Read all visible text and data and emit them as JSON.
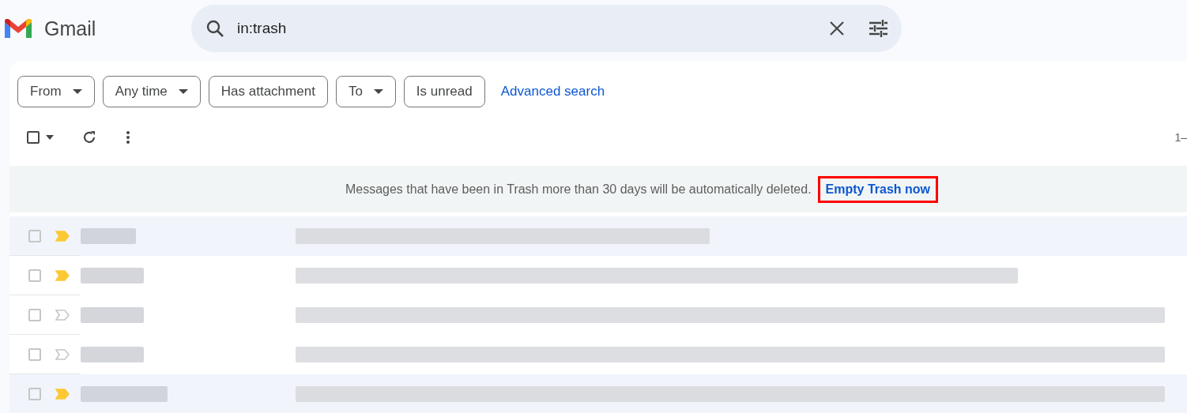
{
  "app": {
    "name": "Gmail"
  },
  "search": {
    "value": "in:trash"
  },
  "filters": [
    {
      "label": "From",
      "kind": "dropdown"
    },
    {
      "label": "Any time",
      "kind": "dropdown"
    },
    {
      "label": "Has attachment",
      "kind": "chip"
    },
    {
      "label": "To",
      "kind": "dropdown"
    },
    {
      "label": "Is unread",
      "kind": "chip"
    },
    {
      "label": "Advanced search",
      "kind": "link"
    }
  ],
  "toolbar": {
    "select_all_checked": false,
    "page_range": "1–"
  },
  "banner": {
    "message": "Messages that have been in Trash more than 30 days will be automatically deleted.",
    "action": "Empty Trash now",
    "action_highlighted": true
  },
  "messages": [
    {
      "checked": false,
      "important": true,
      "read": true
    },
    {
      "checked": false,
      "important": true,
      "read": false
    },
    {
      "checked": false,
      "important": false,
      "read": false
    },
    {
      "checked": false,
      "important": false,
      "read": false
    },
    {
      "checked": false,
      "important": true,
      "read": true
    }
  ]
}
